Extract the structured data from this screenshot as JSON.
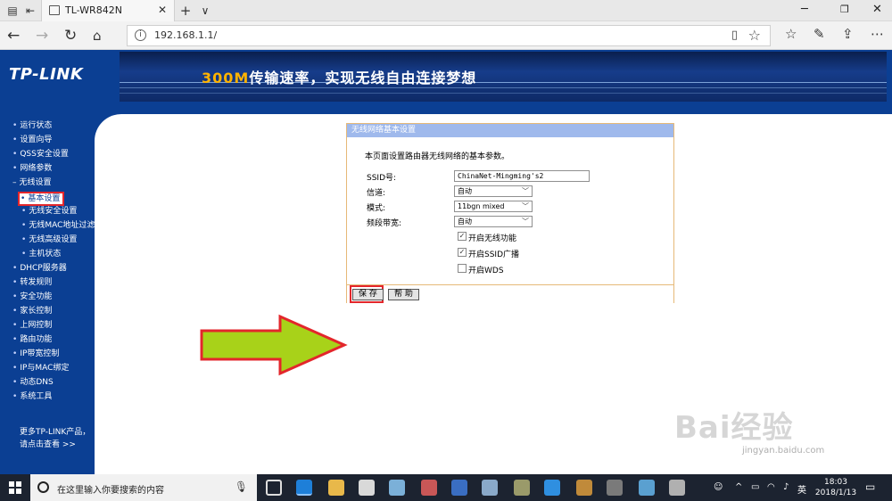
{
  "browser": {
    "tab_title": "TL-WR842N",
    "new_tab": "+",
    "tab_menu": "∨",
    "url": "192.168.1.1/"
  },
  "banner": {
    "logo": "TP-LINK",
    "slogan_highlight": "300M",
    "slogan_rest": "传输速率，实现无线自由连接梦想"
  },
  "menu": {
    "items": [
      "运行状态",
      "设置向导",
      "QSS安全设置",
      "网络参数",
      "无线设置",
      "基本设置",
      "无线安全设置",
      "无线MAC地址过滤",
      "无线高级设置",
      "主机状态",
      "DHCP服务器",
      "转发规则",
      "安全功能",
      "家长控制",
      "上网控制",
      "路由功能",
      "IP带宽控制",
      "IP与MAC绑定",
      "动态DNS",
      "系统工具"
    ],
    "more_line1": "更多TP-LINK产品，",
    "more_line2": "请点击查看 >>"
  },
  "panel": {
    "title": "无线网络基本设置",
    "description": "本页面设置路由器无线网络的基本参数。",
    "ssid_label": "SSID号:",
    "ssid_value": "ChinaNet-Mingming's2",
    "channel_label": "信道:",
    "channel_value": "自动",
    "mode_label": "模式:",
    "mode_value": "11bgn mixed",
    "bandwidth_label": "频段带宽:",
    "bandwidth_value": "自动",
    "cb_wireless": "开启无线功能",
    "cb_ssid_broadcast": "开启SSID广播",
    "cb_wds": "开启WDS",
    "save_label": "保 存",
    "help_label": "帮 助"
  },
  "watermark": {
    "brand": "Bai经验",
    "site": "jingyan.baidu.com"
  },
  "taskbar": {
    "search_placeholder": "在这里输入你要搜索的内容",
    "ime": "英",
    "time": "18:03",
    "date": "2018/1/13"
  },
  "colors": {
    "router_blue": "#0b3f93",
    "panel_header": "#9fb9ec",
    "highlight_red": "#e3262b",
    "arrow_green": "#a8d219"
  }
}
